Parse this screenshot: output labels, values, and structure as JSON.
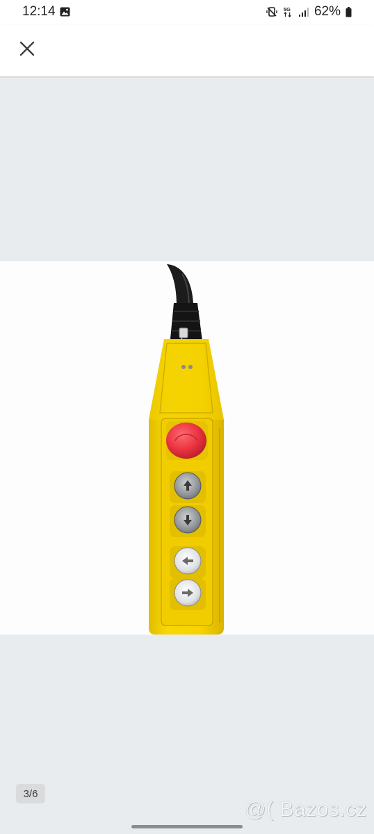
{
  "status_bar": {
    "time": "12:14",
    "battery": "62%",
    "icons": [
      "gallery-icon",
      "mute-vibrate-icon",
      "5g-icon",
      "signal-icon",
      "battery-icon"
    ],
    "network_label": "5G"
  },
  "header": {
    "close_icon": "close-icon"
  },
  "viewer": {
    "image_description_icon": "crane-pendant-control-photo",
    "page_counter": "3/6",
    "watermark": "@( Bazos.cz",
    "colors": {
      "background": "#e9ecef",
      "pendant_yellow": "#f6d200",
      "stop_button_red": "#e8323f"
    }
  }
}
